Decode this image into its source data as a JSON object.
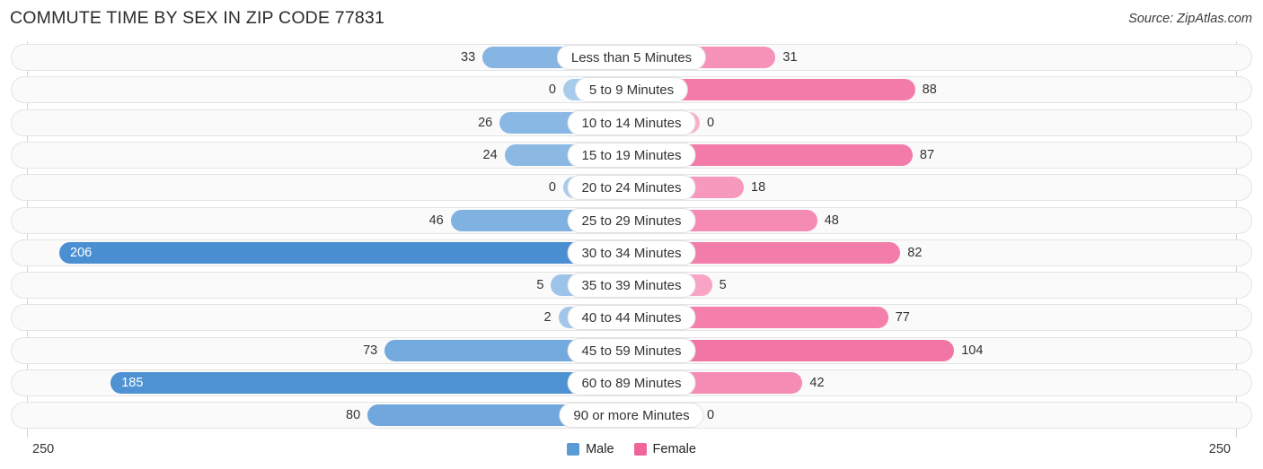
{
  "header": {
    "title": "COMMUTE TIME BY SEX IN ZIP CODE 77831",
    "source": "Source: ZipAtlas.com"
  },
  "legend": {
    "male_label": "Male",
    "female_label": "Female",
    "male_color": "#5B9BD5",
    "female_color": "#F0649A"
  },
  "axis": {
    "left_end": "250",
    "right_end": "250",
    "max": 250
  },
  "chart_data": {
    "type": "bar",
    "subtype": "diverging-bidirectional",
    "title": "COMMUTE TIME BY SEX IN ZIP CODE 77831",
    "xlabel": "",
    "ylabel": "",
    "xlim": [
      -250,
      250
    ],
    "grid": false,
    "legend_position": "bottom-center",
    "categories": [
      "Less than 5 Minutes",
      "5 to 9 Minutes",
      "10 to 14 Minutes",
      "15 to 19 Minutes",
      "20 to 24 Minutes",
      "25 to 29 Minutes",
      "30 to 34 Minutes",
      "35 to 39 Minutes",
      "40 to 44 Minutes",
      "45 to 59 Minutes",
      "60 to 89 Minutes",
      "90 or more Minutes"
    ],
    "series": [
      {
        "name": "Male",
        "side": "left",
        "color": "#5B9BD5",
        "values": [
          33,
          0,
          26,
          24,
          0,
          46,
          206,
          5,
          2,
          73,
          185,
          80
        ],
        "labels": [
          "33",
          "0",
          "26",
          "24",
          "0",
          "46",
          "206",
          "5",
          "2",
          "73",
          "185",
          "80"
        ]
      },
      {
        "name": "Female",
        "side": "right",
        "color": "#F0649A",
        "values": [
          31,
          88,
          0,
          87,
          18,
          48,
          82,
          5,
          77,
          104,
          42,
          0
        ],
        "labels": [
          "31",
          "88",
          "0",
          "87",
          "18",
          "48",
          "82",
          "5",
          "77",
          "104",
          "42",
          "0"
        ]
      }
    ]
  }
}
